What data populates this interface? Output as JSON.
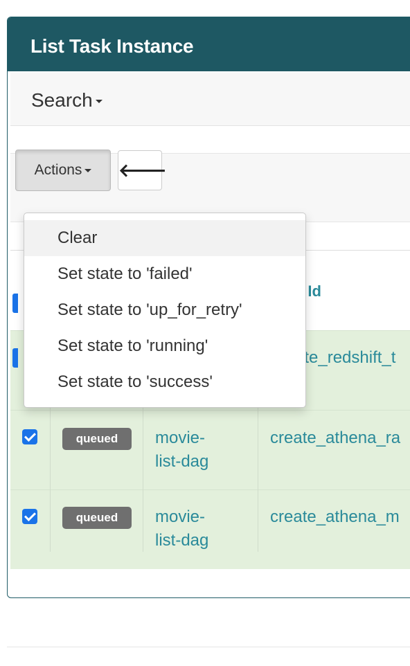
{
  "panel": {
    "title": "List Task Instance"
  },
  "search": {
    "label": "Search"
  },
  "toolbar": {
    "actions_label": "Actions",
    "back_label": "🡐"
  },
  "table": {
    "header_task_id": "k Id",
    "rows": [
      {
        "task_id": "ate_redshift_t"
      },
      {
        "state": "queued",
        "dag_id_line1": "movie-",
        "dag_id_line2": "list-dag",
        "task_id": "create_athena_ra"
      },
      {
        "state": "queued",
        "dag_id_line1": "movie-",
        "dag_id_line2": "list-dag",
        "task_id": "create_athena_m"
      }
    ]
  },
  "dropdown": {
    "items": [
      {
        "label": "Clear"
      },
      {
        "label": "Set state to 'failed'"
      },
      {
        "label": "Set state to 'up_for_retry'"
      },
      {
        "label": "Set state to 'running'"
      },
      {
        "label": "Set state to 'success'"
      }
    ]
  },
  "colors": {
    "header_bg": "#1e5863",
    "row_bg": "#e3f0dc",
    "link": "#2a8a9a",
    "checkbox": "#1a73e8",
    "badge_bg": "#6f6f6f"
  }
}
